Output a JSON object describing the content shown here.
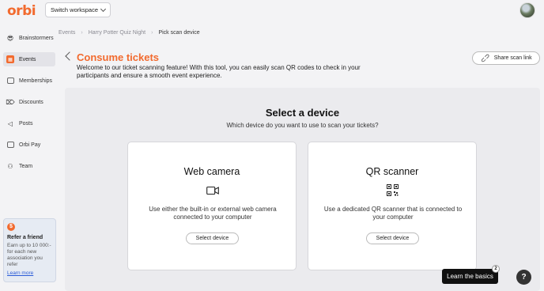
{
  "app": {
    "logo": "orbi",
    "workspace_button": "Switch workspace"
  },
  "breadcrumb": [
    "Events",
    "Harry Potter Quiz Night",
    "Pick scan device"
  ],
  "sidebar": {
    "org": {
      "icon": "smiling-face-sunglasses",
      "label": "Brainstormers"
    },
    "items": [
      {
        "label": "Events",
        "icon": "calendar-icon",
        "active": true
      },
      {
        "label": "Memberships",
        "icon": "id-card-icon",
        "active": false
      },
      {
        "label": "Discounts",
        "icon": "tag-icon",
        "active": false
      },
      {
        "label": "Posts",
        "icon": "megaphone-icon",
        "active": false
      },
      {
        "label": "Orbi Pay",
        "icon": "wallet-icon",
        "active": false
      },
      {
        "label": "Team",
        "icon": "people-icon",
        "active": false
      }
    ],
    "promo": {
      "badge": "$",
      "title": "Refer a friend",
      "text": "Earn up to 10 000:- for each new association you refer",
      "link": "Learn more"
    }
  },
  "page": {
    "title": "Consume tickets",
    "description": "Welcome to our ticket scanning feature! With this tool, you can easily scan QR codes to check in your participants and ensure a smooth event experience.",
    "share_button": "Share scan link"
  },
  "selector": {
    "title": "Select a device",
    "subtitle": "Which device do you want to use to scan your tickets?",
    "cards": [
      {
        "title": "Web camera",
        "icon": "video-camera-icon",
        "description": "Use either the built-in or external web camera connected to your computer",
        "button": "Select device"
      },
      {
        "title": "QR scanner",
        "icon": "qr-code-icon",
        "description": "Use a dedicated QR scanner that is connected to your computer",
        "button": "Select device"
      }
    ]
  },
  "help": {
    "learn_button": "Learn the basics",
    "learn_badge": "2",
    "help_icon": "?"
  },
  "colors": {
    "accent": "#f26a2e",
    "background": "#f3f3f5",
    "panel": "#ebebee",
    "dark": "#111111"
  }
}
